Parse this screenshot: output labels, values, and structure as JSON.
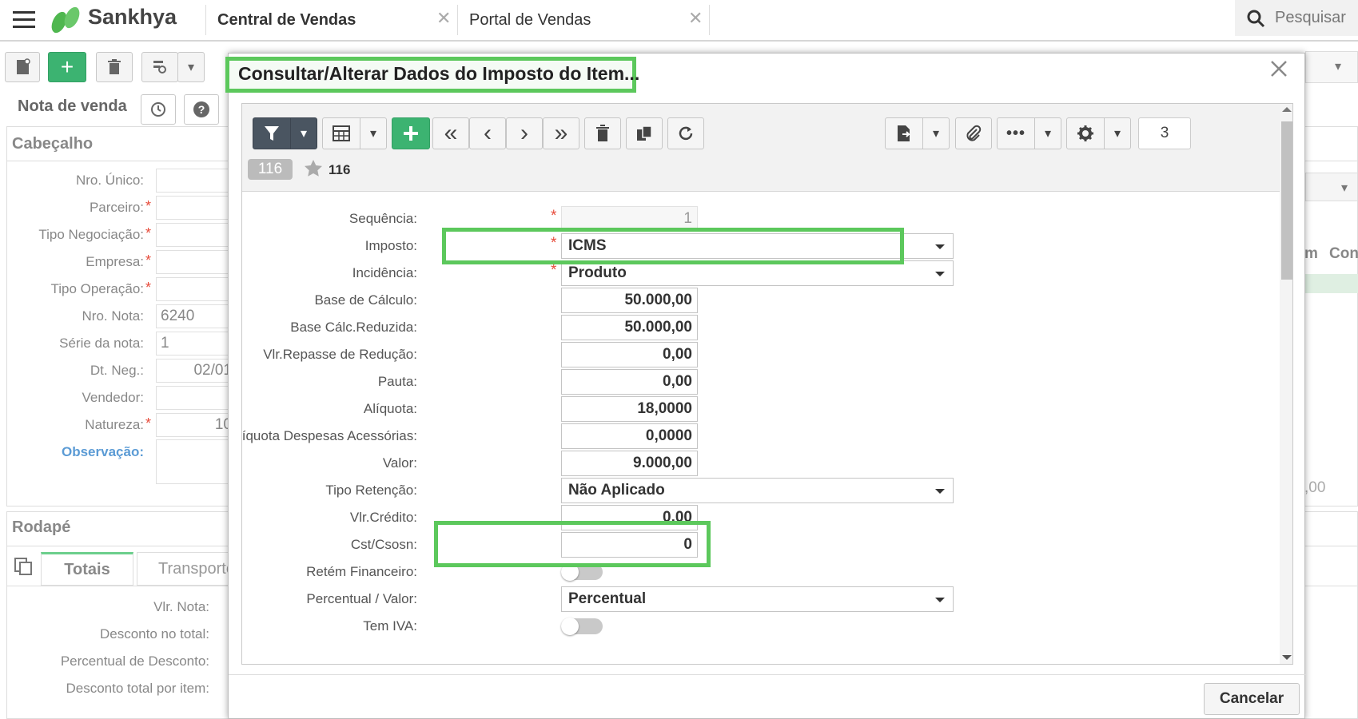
{
  "app": {
    "brand": "Sankhya",
    "search_label": "Pesquisar"
  },
  "tabs": [
    {
      "label": "Central de Vendas"
    },
    {
      "label": "Portal de Vendas"
    }
  ],
  "background": {
    "doc_title": "Nota de venda",
    "header_section": "Cabeçalho",
    "fields": [
      {
        "label": "Nro. Único:",
        "value": ""
      },
      {
        "label": "Parceiro:",
        "value": ""
      },
      {
        "label": "Tipo Negociação:",
        "value": ""
      },
      {
        "label": "Empresa:",
        "value": ""
      },
      {
        "label": "Tipo Operação:",
        "value": ""
      },
      {
        "label": "Nro. Nota:",
        "value": "6240"
      },
      {
        "label": "Série da nota:",
        "value": "1"
      },
      {
        "label": "Dt. Neg.:",
        "value": "02/01"
      },
      {
        "label": "Vendedor:",
        "value": ""
      },
      {
        "label": "Natureza:",
        "value": "10"
      }
    ],
    "observacao_label": "Observação:",
    "footer_section": "Rodapé",
    "footer_tabs": [
      "Totais",
      "Transporte"
    ],
    "totals": [
      {
        "label": "Vlr. Nota:"
      },
      {
        "label": "Desconto no total:"
      },
      {
        "label": "Percentual de Desconto:"
      },
      {
        "label": "Desconto total por item:"
      }
    ],
    "right_cols": [
      "m",
      "Con"
    ],
    "right_value": ",00"
  },
  "dialog": {
    "title": "Consultar/Alterar Dados do Imposto do Item...",
    "record_badge": "116",
    "record_label": "116",
    "page_number": "3",
    "cancel_label": "Cancelar",
    "fields": [
      {
        "label": "Sequência:",
        "value": "1",
        "type": "readonly",
        "required": true
      },
      {
        "label": "Imposto:",
        "value": "ICMS",
        "type": "select",
        "required": true
      },
      {
        "label": "Incidência:",
        "value": "Produto",
        "type": "select",
        "required": true
      },
      {
        "label": "Base de Cálculo:",
        "value": "50.000,00",
        "type": "number"
      },
      {
        "label": "Base Cálc.Reduzida:",
        "value": "50.000,00",
        "type": "number"
      },
      {
        "label": "Vlr.Repasse de Redução:",
        "value": "0,00",
        "type": "number"
      },
      {
        "label": "Pauta:",
        "value": "0,00",
        "type": "number"
      },
      {
        "label": "Alíquota:",
        "value": "18,0000",
        "type": "number"
      },
      {
        "label": "Alíquota Despesas Acessórias:",
        "value": "0,0000",
        "type": "number"
      },
      {
        "label": "Valor:",
        "value": "9.000,00",
        "type": "number"
      },
      {
        "label": "Tipo Retenção:",
        "value": "Não Aplicado",
        "type": "select"
      },
      {
        "label": "Vlr.Crédito:",
        "value": "0,00",
        "type": "number"
      },
      {
        "label": "Cst/Csosn:",
        "value": "0",
        "type": "number"
      },
      {
        "label": "Retém Financeiro:",
        "value": "off",
        "type": "toggle"
      },
      {
        "label": "Percentual / Valor:",
        "value": "Percentual",
        "type": "select"
      },
      {
        "label": "Tem IVA:",
        "value": "off",
        "type": "toggle"
      }
    ]
  },
  "colors": {
    "accent_green": "#5cc85c",
    "primary_button": "#3cb371",
    "filter_button": "#4a5561",
    "required": "#e74c3c"
  }
}
